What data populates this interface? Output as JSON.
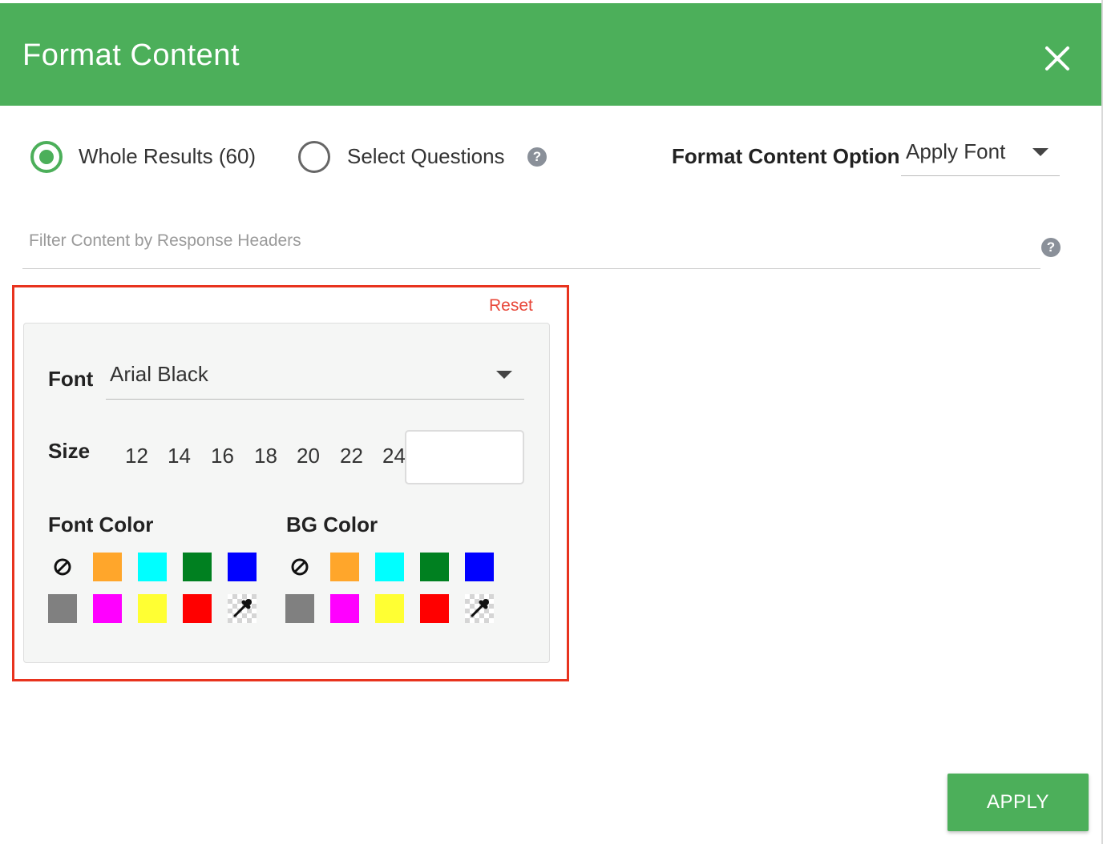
{
  "dialog": {
    "title": "Format Content"
  },
  "scope": {
    "options": [
      {
        "label": "Whole Results (60)",
        "selected": true
      },
      {
        "label": "Select Questions",
        "selected": false
      }
    ]
  },
  "format_option": {
    "label": "Format Content Option",
    "value": "Apply Font"
  },
  "filter": {
    "placeholder": "Filter Content by Response Headers"
  },
  "font_panel": {
    "reset_label": "Reset",
    "font_label": "Font",
    "font_value": "Arial Black",
    "size_label": "Size",
    "sizes": [
      "12",
      "14",
      "16",
      "18",
      "20",
      "22",
      "24"
    ],
    "font_color_label": "Font Color",
    "bg_color_label": "BG Color",
    "palette": [
      "#ffa62b",
      "#00ffff",
      "#008020",
      "#0000ff",
      "#808080",
      "#ff00ff",
      "#ffff33",
      "#ff0000"
    ]
  },
  "actions": {
    "apply_label": "APPLY"
  },
  "colors": {
    "accent": "#4caf5a",
    "highlight": "#e8331e",
    "reset": "#e8483a"
  }
}
